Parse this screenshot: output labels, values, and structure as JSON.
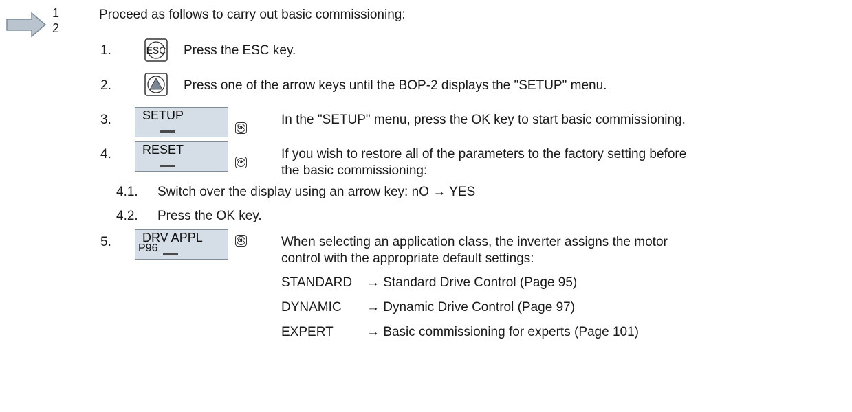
{
  "procedure_marker": {
    "num1": "1",
    "num2": "2"
  },
  "intro": "Proceed as follows to carry out basic commissioning:",
  "steps": [
    {
      "num": "1.",
      "key": "ESC",
      "text": "Press the ESC key."
    },
    {
      "num": "2.",
      "text": "Press one of the arrow keys until the BOP-2 displays the \"SETUP\" menu."
    },
    {
      "num": "3.",
      "display": "SETUP",
      "ok": "OK",
      "text": "In the \"SETUP\" menu, press the OK key to start basic commissioning."
    },
    {
      "num": "4.",
      "display": "RESET",
      "ok": "OK",
      "text_line1": "If you wish to restore all of the parameters to the factory setting before",
      "text_line2": "the basic commissioning:"
    },
    {
      "num": "5.",
      "display_line1": "DRV APPL",
      "display_line2": "P96",
      "ok": "OK",
      "text_line1": "When selecting an application class, the inverter assigns the motor",
      "text_line2": "control with the appropriate default settings:"
    }
  ],
  "substeps": [
    {
      "num": "4.1.",
      "text": "Switch over the display using an arrow key: nO → YES"
    },
    {
      "num": "4.2.",
      "text": "Press the OK key."
    }
  ],
  "app_classes": [
    {
      "name": "STANDARD",
      "desc": "→ Standard Drive Control (Page 95)"
    },
    {
      "name": "DYNAMIC",
      "desc": "→ Dynamic Drive Control (Page 97)"
    },
    {
      "name": "EXPERT",
      "desc": "→ Basic commissioning for experts (Page 101)"
    }
  ],
  "colors": {
    "arrow_fill": "#b9c4cf",
    "display_bg": "#d5dde6",
    "display_border": "#7e8b98"
  }
}
